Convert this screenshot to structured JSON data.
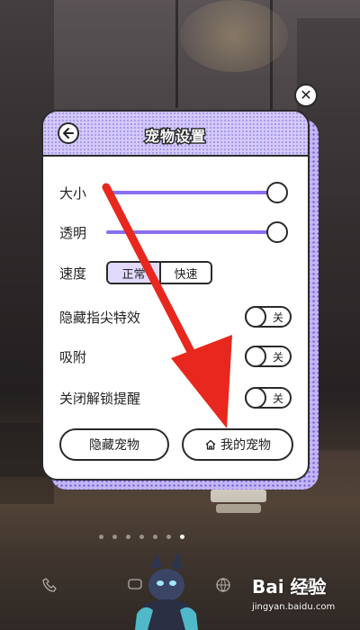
{
  "dialog": {
    "title": "宠物设置",
    "back_icon": "arrow-left-icon",
    "close_icon": "close-icon"
  },
  "settings": {
    "size_label": "大小",
    "size_value": 1.0,
    "opacity_label": "透明",
    "opacity_value": 1.0,
    "speed_label": "速度",
    "speed_options": [
      "正常",
      "快速"
    ],
    "speed_selected": "正常",
    "hide_touch_effect_label": "隐藏指尖特效",
    "hide_touch_effect_state": "关",
    "snap_label": "吸附",
    "snap_state": "关",
    "unlock_reminder_label": "关闭解锁提醒",
    "unlock_reminder_state": "关"
  },
  "buttons": {
    "hide_pet": "隐藏宠物",
    "my_pet": "我的宠物",
    "my_pet_icon": "home-icon"
  },
  "pager": {
    "count": 7,
    "active_index": 6
  },
  "watermark": {
    "main": "Bai 经验",
    "sub": "jingyan.baidu.com"
  },
  "colors": {
    "accent": "#8b6ff0",
    "arrow": "#e8281e",
    "header_bg": "#d6ccfb"
  }
}
